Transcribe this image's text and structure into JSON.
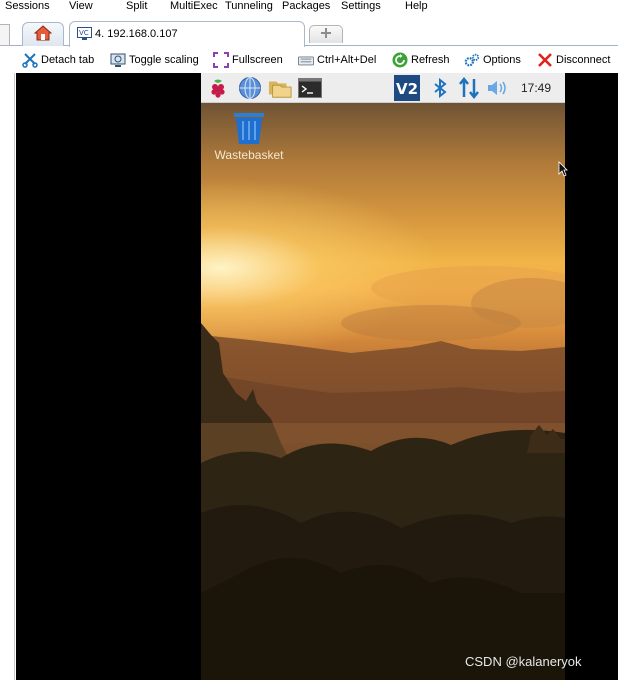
{
  "menu": {
    "items": [
      "Sessions",
      "View",
      "Split",
      "MultiExec",
      "Tunneling",
      "Packages",
      "Settings",
      "Help"
    ]
  },
  "tabs": {
    "home_icon": "home-icon",
    "session_title": "4. 192.168.0.107",
    "new_tab_icon": "plus-icon"
  },
  "toolbar": {
    "detach_label": "Detach tab",
    "toggle_scaling_label": "Toggle scaling",
    "fullscreen_label": "Fullscreen",
    "ctrl_alt_del_label": "Ctrl+Alt+Del",
    "refresh_label": "Refresh",
    "options_label": "Options",
    "disconnect_label": "Disconnect"
  },
  "remote_desktop": {
    "taskbar": {
      "icons": [
        "raspberry-menu-icon",
        "web-browser-icon",
        "file-manager-icon",
        "terminal-icon",
        "vnc-icon",
        "bluetooth-icon",
        "network-icon",
        "volume-icon"
      ],
      "clock": "17:49"
    },
    "desktop_icons": [
      {
        "label": "Wastebasket",
        "icon": "wastebasket-icon"
      }
    ]
  },
  "watermark": "CSDN @kalaneryok",
  "colors": {
    "accent_blue": "#1e73be",
    "disconnect_red": "#e0231c",
    "refresh_green": "#3aa335"
  }
}
